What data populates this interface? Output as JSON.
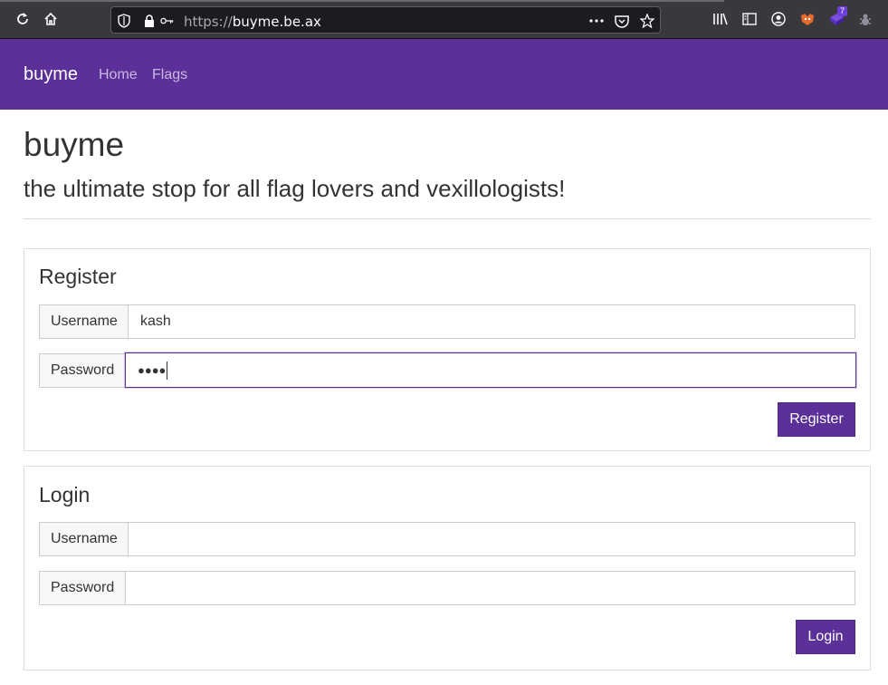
{
  "browser": {
    "url_scheme": "https://",
    "url_host": "buyme.be.ax",
    "extension_badge": "7",
    "icons": [
      "reload-icon",
      "home-icon",
      "shield-icon",
      "lock-icon",
      "key-icon",
      "more-icon",
      "pocket-icon",
      "star-icon",
      "library-icon",
      "sidebar-icon",
      "account-icon",
      "extension-fox-icon",
      "extension-cube-icon",
      "extension-bug-icon"
    ]
  },
  "navbar": {
    "brand": "buyme",
    "links": [
      "Home",
      "Flags"
    ]
  },
  "header": {
    "title": "buyme",
    "subtitle": "the ultimate stop for all flag lovers and vexillologists!"
  },
  "register": {
    "title": "Register",
    "username_label": "Username",
    "username_value": "kash",
    "password_label": "Password",
    "password_masked": "●●●●",
    "button": "Register"
  },
  "login": {
    "title": "Login",
    "username_label": "Username",
    "username_value": "",
    "password_label": "Password",
    "password_value": "",
    "button": "Login"
  },
  "colors": {
    "brand_purple": "#5b3099",
    "browser_chrome": "#38383d"
  }
}
